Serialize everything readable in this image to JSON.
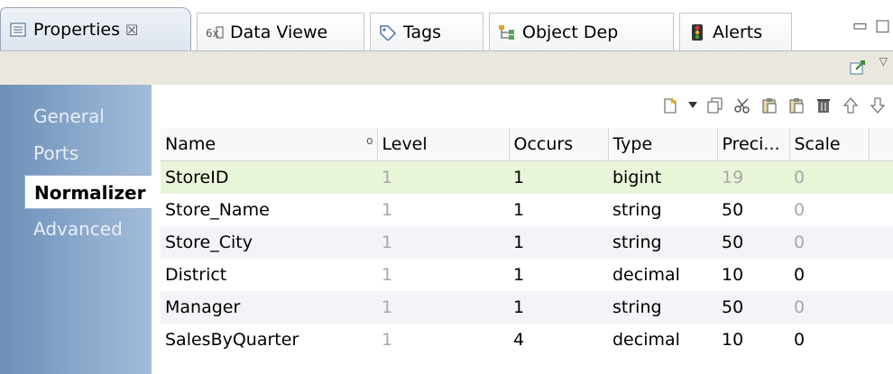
{
  "tabs": [
    {
      "label": "Properties",
      "icon": "properties-icon",
      "close": "☒",
      "active": true
    },
    {
      "label": "Data Viewe",
      "icon": "data-viewer-icon"
    },
    {
      "label": "Tags",
      "icon": "tag-icon"
    },
    {
      "label": "Object Dep",
      "icon": "object-dependency-icon"
    },
    {
      "label": "Alerts",
      "icon": "alerts-icon"
    }
  ],
  "nav": [
    {
      "label": "General"
    },
    {
      "label": "Ports"
    },
    {
      "label": "Normalizer",
      "selected": true
    },
    {
      "label": "Advanced"
    }
  ],
  "toolbar": [
    "new-icon",
    "dropdown-arrow-icon",
    "copy-icon",
    "cut-icon",
    "paste-icon",
    "paste-icon",
    "delete-icon",
    "move-up-icon",
    "move-down-icon"
  ],
  "table": {
    "headers": [
      "Name",
      "Level",
      "Occurs",
      "Type",
      "Preci...",
      "Scale"
    ],
    "rows": [
      {
        "name": "StoreID",
        "level": "1",
        "occurs": "1",
        "type": "bigint",
        "precision": "19",
        "scale": "0"
      },
      {
        "name": "Store_Name",
        "level": "1",
        "occurs": "1",
        "type": "string",
        "precision": "50",
        "scale": "0"
      },
      {
        "name": "Store_City",
        "level": "1",
        "occurs": "1",
        "type": "string",
        "precision": "50",
        "scale": "0"
      },
      {
        "name": "District",
        "level": "1",
        "occurs": "1",
        "type": "decimal",
        "precision": "10",
        "scale": "0"
      },
      {
        "name": "Manager",
        "level": "1",
        "occurs": "1",
        "type": "string",
        "precision": "50",
        "scale": "0"
      },
      {
        "name": "SalesByQuarter",
        "level": "1",
        "occurs": "4",
        "type": "decimal",
        "precision": "10",
        "scale": "0"
      }
    ]
  },
  "colors": {
    "selected_row": "#e8f5d8",
    "nav_gradient_start": "#6e8fb7",
    "band": "#eae8de"
  }
}
